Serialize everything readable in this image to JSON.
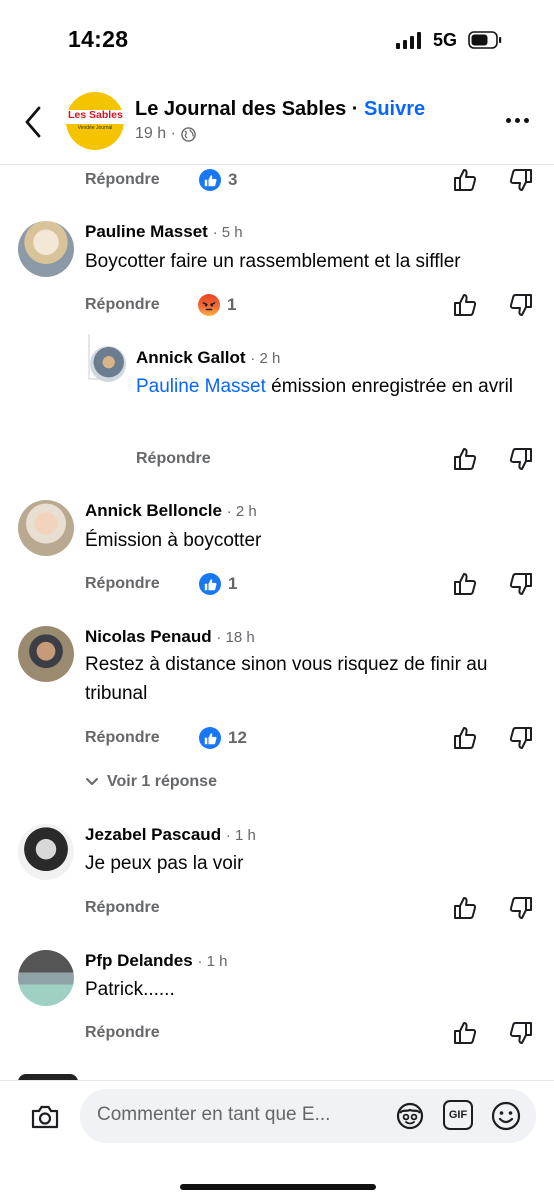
{
  "status_bar": {
    "time": "14:28",
    "network": "5G"
  },
  "header": {
    "page_name": "Le Journal des Sables",
    "separator": "·",
    "follow_label": "Suivre",
    "post_time": "19 h ·",
    "logo_text": "Les Sables",
    "logo_subtext": "Vendée Journal"
  },
  "prev_comment": {
    "reply_label": "Répondre",
    "reaction_count": "3",
    "reaction": "like"
  },
  "comments": [
    {
      "author": "Pauline Masset",
      "time": "· 5 h",
      "text": "Boycotter faire un rassemblement  et la siffler",
      "reply_label": "Répondre",
      "reaction": "angry",
      "reaction_count": "1"
    },
    {
      "author": "Annick Gallot",
      "time": "· 2 h",
      "mention": "Pauline Masset",
      "text": " émission enregistrée  en avril",
      "reply_label": "Répondre",
      "is_reply": true
    },
    {
      "author": "Annick Belloncle",
      "time": "· 2 h",
      "text": "Émission à boycotter",
      "reply_label": "Répondre",
      "reaction": "like",
      "reaction_count": "1"
    },
    {
      "author": "Nicolas Penaud",
      "time": "· 18 h",
      "text": "Restez à distance sinon vous risquez de finir au tribunal",
      "reply_label": "Répondre",
      "reaction": "like",
      "reaction_count": "12",
      "view_replies": "Voir 1 réponse"
    },
    {
      "author": "Jezabel Pascaud",
      "time": "· 1 h",
      "text": "Je peux pas la voir",
      "reply_label": "Répondre"
    },
    {
      "author": "Pfp Delandes",
      "time": "· 1 h",
      "text": "Patrick......",
      "reply_label": "Répondre"
    }
  ],
  "footer": {
    "placeholder": "Commenter en tant que E...",
    "gif_label": "GIF"
  },
  "colors": {
    "accent": "#0866ff",
    "like": "#1877f2",
    "muted": "#65676b"
  }
}
